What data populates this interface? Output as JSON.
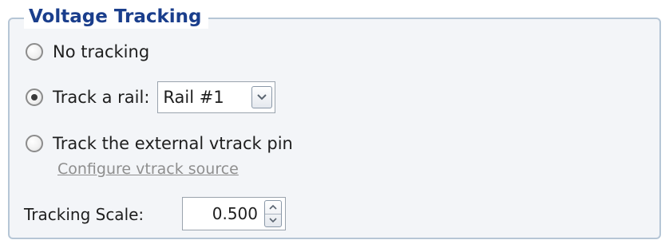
{
  "group": {
    "title": "Voltage Tracking"
  },
  "options": [
    {
      "label": "No tracking",
      "selected": false
    },
    {
      "label": "Track a rail:",
      "selected": true
    },
    {
      "label": "Track the external vtrack pin",
      "selected": false
    }
  ],
  "rail_select": {
    "value": "Rail #1",
    "icon": "chevron-down-icon"
  },
  "configure_link": "Configure vtrack source",
  "tracking_scale": {
    "label": "Tracking Scale:",
    "value": "0.500",
    "up_icon": "spin-up-icon",
    "down_icon": "spin-down-icon"
  },
  "colors": {
    "accent": "#1a3e8c",
    "border": "#b6c6d6",
    "panel": "#f3f5f8",
    "link_disabled": "#8e8e8e"
  }
}
